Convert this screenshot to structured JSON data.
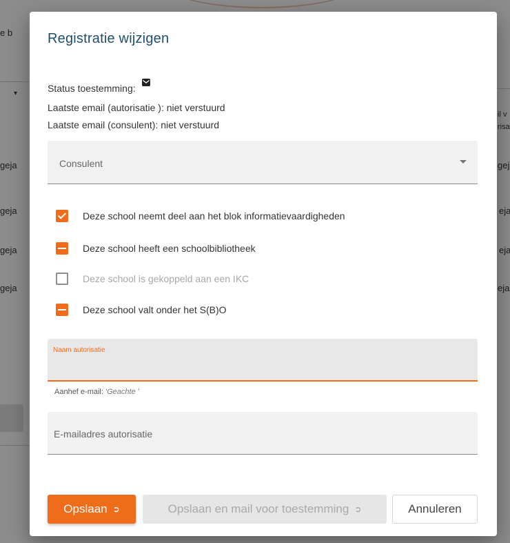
{
  "dialog": {
    "title": "Registratie wijzigen",
    "status_label": "Status toestemming:",
    "last_email_authorisation": "Laatste email (autorisatie ): niet verstuurd",
    "last_email_consultant": "Laatste email (consulent): niet verstuurd",
    "consultant_select": {
      "placeholder": "Consulent"
    },
    "checkboxes": [
      {
        "label": "Deze school neemt deel aan het blok informatievaardigheden",
        "state": "checked"
      },
      {
        "label": "Deze school heeft een schoolbibliotheek",
        "state": "indeterminate"
      },
      {
        "label": "Deze school is gekoppeld aan een IKC",
        "state": "unchecked-disabled"
      },
      {
        "label": "Deze school valt onder het S(B)O",
        "state": "indeterminate"
      }
    ],
    "name_field": {
      "label": "Naam autorisatie",
      "value": ""
    },
    "salutation_hint": {
      "prefix": "Aanhef e-mail:",
      "value": "'Geachte '"
    },
    "email_field": {
      "placeholder": "E-mailadres autorisatie",
      "value": ""
    },
    "buttons": {
      "save": "Opslaan",
      "save_and_mail": "Opslaan en mail voor toestemming",
      "cancel": "Annuleren"
    }
  },
  "background": {
    "snippets": [
      "e b",
      "geja",
      "geja",
      "geja",
      "geja",
      "geja",
      "eja",
      "eja",
      "eja",
      "il v",
      "risa"
    ]
  },
  "colors": {
    "accent": "#ef6c1a",
    "title": "#1d4e6e"
  },
  "icons": {
    "status": "envelope-icon",
    "button_arrow": "arrow-right-icon",
    "select": "chevron-down-icon"
  }
}
